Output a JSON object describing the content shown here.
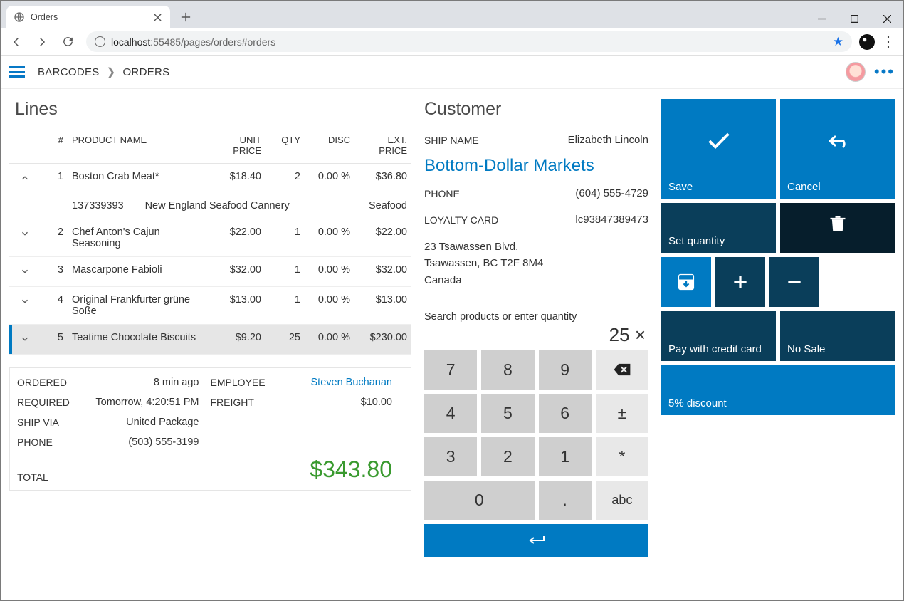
{
  "browser": {
    "tab_title": "Orders",
    "url_prefix": "localhost:",
    "url_rest": "55485/pages/orders#orders"
  },
  "header": {
    "crumb1": "BARCODES",
    "crumb2": "ORDERS"
  },
  "lines": {
    "title": "Lines",
    "columns": {
      "num": "#",
      "name": "PRODUCT NAME",
      "unit": "UNIT PRICE",
      "qty": "QTY",
      "disc": "DISC",
      "ext": "EXT. PRICE"
    },
    "rows": [
      {
        "expanded": true,
        "num": "1",
        "name": "Boston Crab Meat*",
        "unit": "$18.40",
        "qty": "2",
        "disc": "0.00 %",
        "ext": "$36.80",
        "sub_code": "137339393",
        "sub_supplier": "New England Seafood Cannery",
        "sub_cat": "Seafood"
      },
      {
        "expanded": false,
        "num": "2",
        "name": "Chef Anton's Cajun Seasoning",
        "unit": "$22.00",
        "qty": "1",
        "disc": "0.00 %",
        "ext": "$22.00"
      },
      {
        "expanded": false,
        "num": "3",
        "name": "Mascarpone Fabioli",
        "unit": "$32.00",
        "qty": "1",
        "disc": "0.00 %",
        "ext": "$32.00"
      },
      {
        "expanded": false,
        "num": "4",
        "name": "Original Frankfurter grüne Soße",
        "unit": "$13.00",
        "qty": "1",
        "disc": "0.00 %",
        "ext": "$13.00"
      },
      {
        "expanded": false,
        "num": "5",
        "name": "Teatime Chocolate Biscuits",
        "unit": "$9.20",
        "qty": "25",
        "disc": "0.00 %",
        "ext": "$230.00",
        "selected": true
      }
    ]
  },
  "summary": {
    "ordered_label": "ORDERED",
    "ordered_val": "8 min ago",
    "employee_label": "EMPLOYEE",
    "employee_val": "Steven Buchanan",
    "required_label": "REQUIRED",
    "required_val": "Tomorrow, 4:20:51 PM",
    "freight_label": "FREIGHT",
    "freight_val": "$10.00",
    "shipvia_label": "SHIP VIA",
    "shipvia_val": "United Package",
    "phone_label": "PHONE",
    "phone_val": "(503) 555-3199",
    "total_label": "TOTAL",
    "total_val": "$343.80"
  },
  "customer": {
    "title": "Customer",
    "shipname_label": "SHIP NAME",
    "shipname_val": "Elizabeth Lincoln",
    "company": "Bottom-Dollar Markets",
    "phone_label": "PHONE",
    "phone_val": "(604) 555-4729",
    "loyalty_label": "LOYALTY CARD",
    "loyalty_val": "lc93847389473",
    "addr1": "23 Tsawassen Blvd.",
    "addr2": "Tsawassen, BC T2F 8M4",
    "addr3": "Canada",
    "search_label": "Search products or enter quantity",
    "search_val": "25 ×"
  },
  "keypad": {
    "k7": "7",
    "k8": "8",
    "k9": "9",
    "k4": "4",
    "k5": "5",
    "k6": "6",
    "kpm": "±",
    "k3": "3",
    "k2": "2",
    "k1": "1",
    "kmul": "*",
    "k0": "0",
    "kdot": ".",
    "kabc": "abc"
  },
  "actions": {
    "save": "Save",
    "cancel": "Cancel",
    "setqty": "Set quantity",
    "paycc": "Pay with credit card",
    "nosale": "No Sale",
    "discount": "5% discount"
  }
}
